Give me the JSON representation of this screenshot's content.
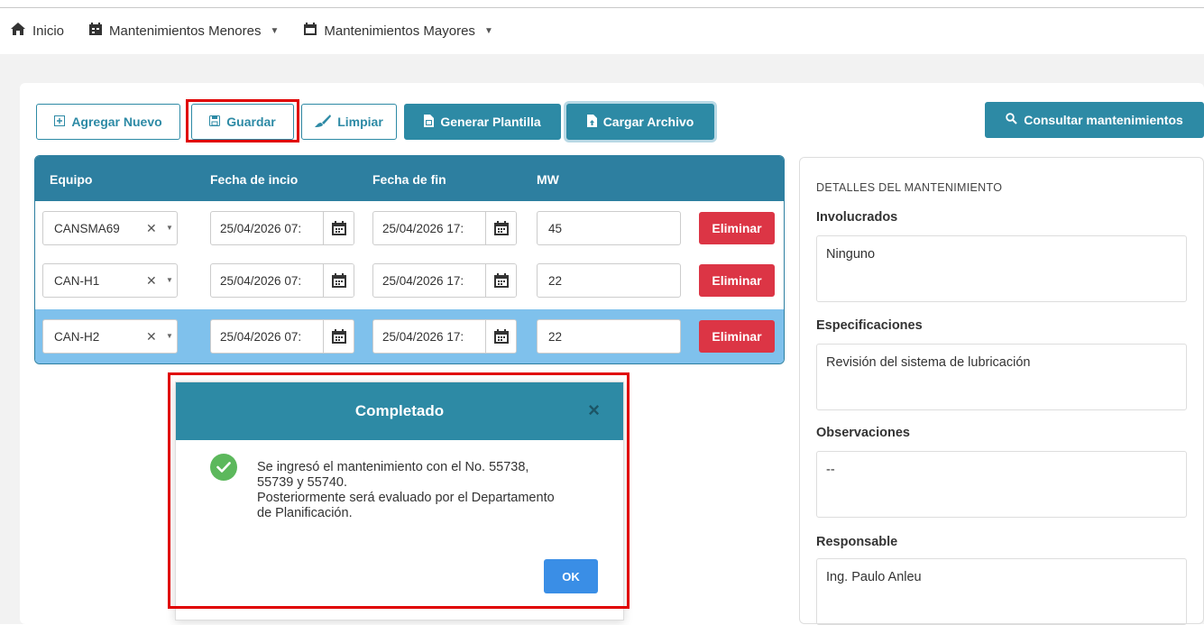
{
  "nav": {
    "home": "Inicio",
    "minor": "Mantenimientos Menores",
    "major": "Mantenimientos Mayores"
  },
  "toolbar": {
    "add": "Agregar Nuevo",
    "save": "Guardar",
    "clear": "Limpiar",
    "template": "Generar Plantilla",
    "upload": "Cargar Archivo",
    "consult": "Consultar mantenimientos"
  },
  "table": {
    "headers": [
      "Equipo",
      "Fecha de incio",
      "Fecha de fin",
      "MW"
    ],
    "rows": [
      {
        "equipo": "CANSMA69",
        "inicio": "25/04/2026 07:",
        "fin": "25/04/2026 17:",
        "mw": "45",
        "delete": "Eliminar"
      },
      {
        "equipo": "CAN-H1",
        "inicio": "25/04/2026 07:",
        "fin": "25/04/2026 17:",
        "mw": "22",
        "delete": "Eliminar"
      },
      {
        "equipo": "CAN-H2",
        "inicio": "25/04/2026 07:",
        "fin": "25/04/2026 17:",
        "mw": "22",
        "delete": "Eliminar"
      }
    ],
    "selected_row": 3
  },
  "details": {
    "title": "DETALLES DEL MANTENIMIENTO",
    "involucrados_label": "Involucrados",
    "involucrados": "Ninguno",
    "especificaciones_label": "Especificaciones",
    "especificaciones": "Revisión del sistema de lubricación",
    "observaciones_label": "Observaciones",
    "observaciones": "--",
    "responsable_label": "Responsable",
    "responsable": "Ing. Paulo Anleu"
  },
  "modal": {
    "title": "Completado",
    "close": "×",
    "line1": "Se ingresó el mantenimiento con el No. 55738,",
    "line2": "55739 y 55740.",
    "line3": "Posteriormente será evaluado por el Departamento",
    "line4": "de Planificación.",
    "ok": "OK"
  },
  "colors": {
    "primary": "#2d8aa5",
    "header": "#2d7fa0",
    "danger": "#dc3545",
    "selected_row": "#7fc1ec",
    "success": "#5cb85c",
    "ok_button": "#3a8ee6",
    "highlight": "#e00000"
  },
  "icons": {
    "home": "home-icon",
    "calendar": "calendar-icon",
    "add": "plus-square-icon",
    "save": "floppy-disk-icon",
    "clear": "brush-icon",
    "template": "file-icon",
    "upload": "file-upload-icon",
    "search": "search-icon",
    "success": "check-circle-icon"
  }
}
